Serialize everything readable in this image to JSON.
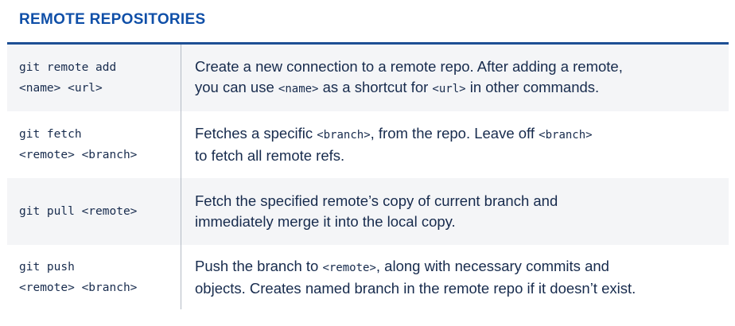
{
  "section_title": "REMOTE REPOSITORIES",
  "rows": [
    {
      "command_line1": "git remote add",
      "command_line2": "<name> <url>",
      "desc_line1": [
        {
          "text": "Create a new connection to a remote repo. After adding a remote,",
          "mono": false
        }
      ],
      "desc_line2": [
        {
          "text": "you can use ",
          "mono": false
        },
        {
          "text": "<name>",
          "mono": true
        },
        {
          "text": " as a shortcut for ",
          "mono": false
        },
        {
          "text": "<url>",
          "mono": true
        },
        {
          "text": " in other commands.",
          "mono": false
        }
      ]
    },
    {
      "command_line1": "git fetch",
      "command_line2": "<remote> <branch>",
      "desc_line1": [
        {
          "text": "Fetches a specific ",
          "mono": false
        },
        {
          "text": "<branch>",
          "mono": true
        },
        {
          "text": ", from the repo. Leave off ",
          "mono": false
        },
        {
          "text": "<branch>",
          "mono": true
        }
      ],
      "desc_line2": [
        {
          "text": "to fetch all remote refs.",
          "mono": false
        }
      ]
    },
    {
      "command_line1": "git pull <remote>",
      "command_line2": "",
      "desc_line1": [
        {
          "text": "Fetch the specified remote’s copy of current branch and",
          "mono": false
        }
      ],
      "desc_line2": [
        {
          "text": "immediately merge it into the local copy.",
          "mono": false
        }
      ]
    },
    {
      "command_line1": "git push",
      "command_line2": "<remote> <branch>",
      "desc_line1": [
        {
          "text": "Push the branch to ",
          "mono": false
        },
        {
          "text": "<remote>",
          "mono": true
        },
        {
          "text": ", along with necessary commits and",
          "mono": false
        }
      ],
      "desc_line2": [
        {
          "text": "objects. Creates named branch in the remote repo if it doesn’t exist.",
          "mono": false
        }
      ]
    }
  ],
  "colors": {
    "title": "#0f4fa8",
    "rule": "#1d4f94",
    "text": "#172b4d",
    "shaded_row": "#f4f5f7",
    "divider": "#b3bac4"
  }
}
